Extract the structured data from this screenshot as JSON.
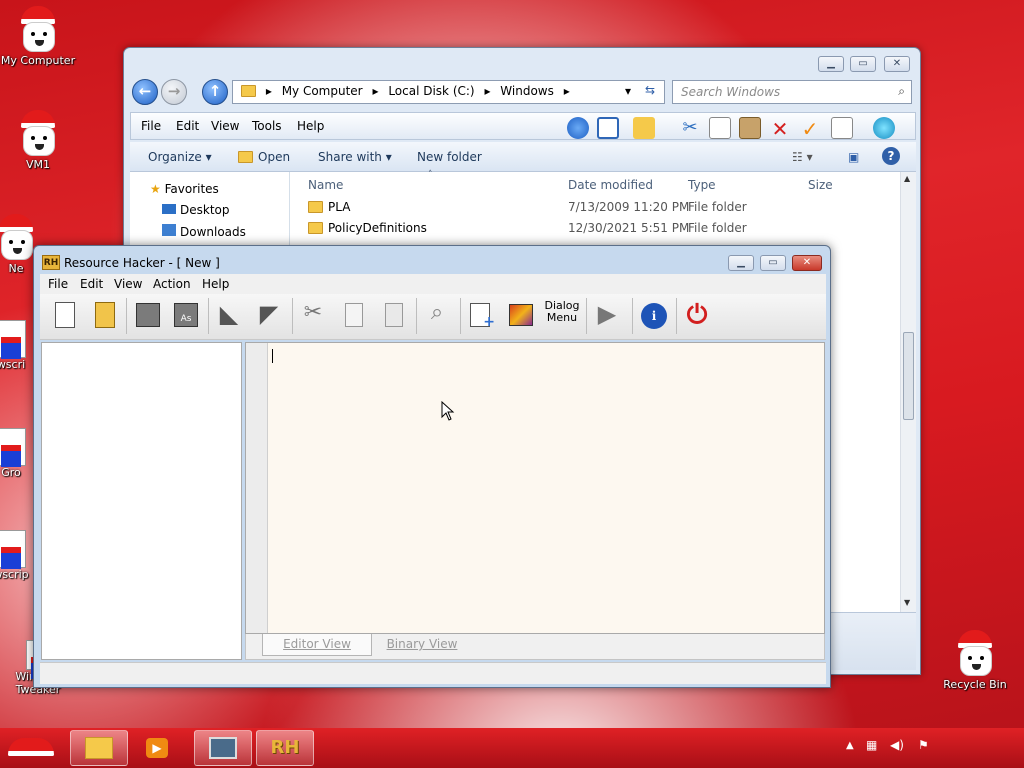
{
  "desktop": {
    "icons": [
      {
        "label": "My Computer"
      },
      {
        "label": "VM1"
      },
      {
        "label": "Ne"
      },
      {
        "label": "wscri"
      },
      {
        "label": "Gro"
      },
      {
        "label": "wscrip"
      },
      {
        "label": "Winaero Tweaker"
      },
      {
        "label": "Recycle Bin"
      }
    ]
  },
  "explorer": {
    "breadcrumb": [
      "My Computer",
      "Local Disk (C:)",
      "Windows"
    ],
    "search_placeholder": "Search Windows",
    "menu": [
      "File",
      "Edit",
      "View",
      "Tools",
      "Help"
    ],
    "commands": {
      "organize": "Organize",
      "open": "Open",
      "share": "Share with",
      "new_folder": "New folder"
    },
    "nav": {
      "favorites": "Favorites",
      "desktop": "Desktop",
      "downloads": "Downloads"
    },
    "columns": {
      "name": "Name",
      "date": "Date modified",
      "type": "Type",
      "size": "Size"
    },
    "files": [
      {
        "name": "PLA",
        "date": "7/13/2009 11:20 PM",
        "type": "File folder"
      },
      {
        "name": "PolicyDefinitions",
        "date": "12/30/2021 5:51 PM",
        "type": "File folder"
      }
    ]
  },
  "rh": {
    "logo": "RH",
    "title": "Resource Hacker - [ New ]",
    "menu": [
      "File",
      "Edit",
      "View",
      "Action",
      "Help"
    ],
    "dialog_btn_line1": "Dialog",
    "dialog_btn_line2": "Menu",
    "tabs": {
      "editor": "Editor View",
      "binary": "Binary View"
    }
  },
  "taskbar": {
    "rh_label": "RH"
  },
  "colors": {
    "accent": "#1d5fc4",
    "taskbar": "#c8141a"
  }
}
